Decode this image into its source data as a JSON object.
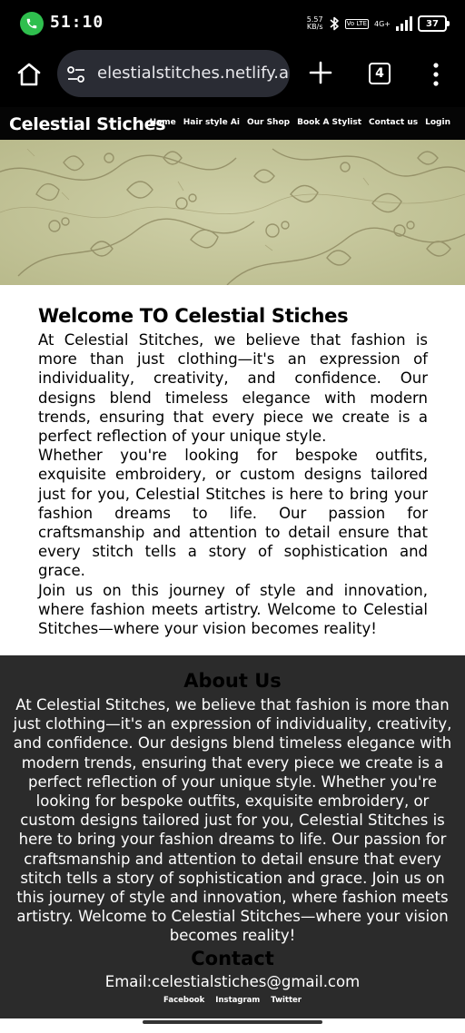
{
  "status_bar": {
    "time": "51:10",
    "net_speed_value": "5.57",
    "net_speed_unit": "KB/s",
    "volte": "Vo LTE",
    "network": "4G+",
    "battery": "37",
    "call_color": "#2fbf4e"
  },
  "browser": {
    "url": "elestialstitches.netlify.app",
    "tab_count": "4"
  },
  "site": {
    "brand": "Celestial Stiches",
    "nav": [
      "Home",
      "Hair style Ai",
      "Our Shop",
      "Book A Stylist",
      "Contact us",
      "Login"
    ]
  },
  "welcome": {
    "heading": "Welcome TO Celestial Stiches",
    "paragraphs": [
      "At Celestial Stitches, we believe that fashion is more than just clothing—it's an expression of individuality, creativity, and confidence. Our designs blend timeless elegance with modern trends, ensuring that every piece we create is a perfect reflection of your unique style.",
      "Whether you're looking for bespoke outfits, exquisite embroidery, or custom designs tailored just for you, Celestial Stitches is here to bring your fashion dreams to life. Our passion for craftsmanship and attention to detail ensure that every stitch tells a story of sophistication and grace.",
      "Join us on this journey of style and innovation, where fashion meets artistry. Welcome to Celestial Stitches—where your vision becomes reality!"
    ]
  },
  "about": {
    "heading": "About Us",
    "text": "At Celestial Stitches, we believe that fashion is more than just clothing—it's an expression of individuality, creativity, and confidence. Our designs blend timeless elegance with modern trends, ensuring that every piece we create is a perfect reflection of your unique style. Whether you're looking for bespoke outfits, exquisite embroidery, or custom designs tailored just for you, Celestial Stitches is here to bring your fashion dreams to life. Our passion for craftsmanship and attention to detail ensure that every stitch tells a story of sophistication and grace. Join us on this journey of style and innovation, where fashion meets artistry. Welcome to Celestial Stitches—where your vision becomes reality!"
  },
  "contact": {
    "heading": "Contact",
    "email": "Email:celestialstiches@gmail.com",
    "social": [
      "Facebook",
      "Instagram",
      "Twitter"
    ]
  },
  "colors": {
    "hero_bg": "#c4c59a",
    "footer_bg": "#2b2b2b",
    "nav_bg": "#050505"
  },
  "icons": [
    "call-icon",
    "bluetooth-icon",
    "signal-icon",
    "battery-icon",
    "home-icon",
    "site-settings-icon",
    "new-tab-icon",
    "tab-switcher-icon",
    "more-menu-icon"
  ]
}
